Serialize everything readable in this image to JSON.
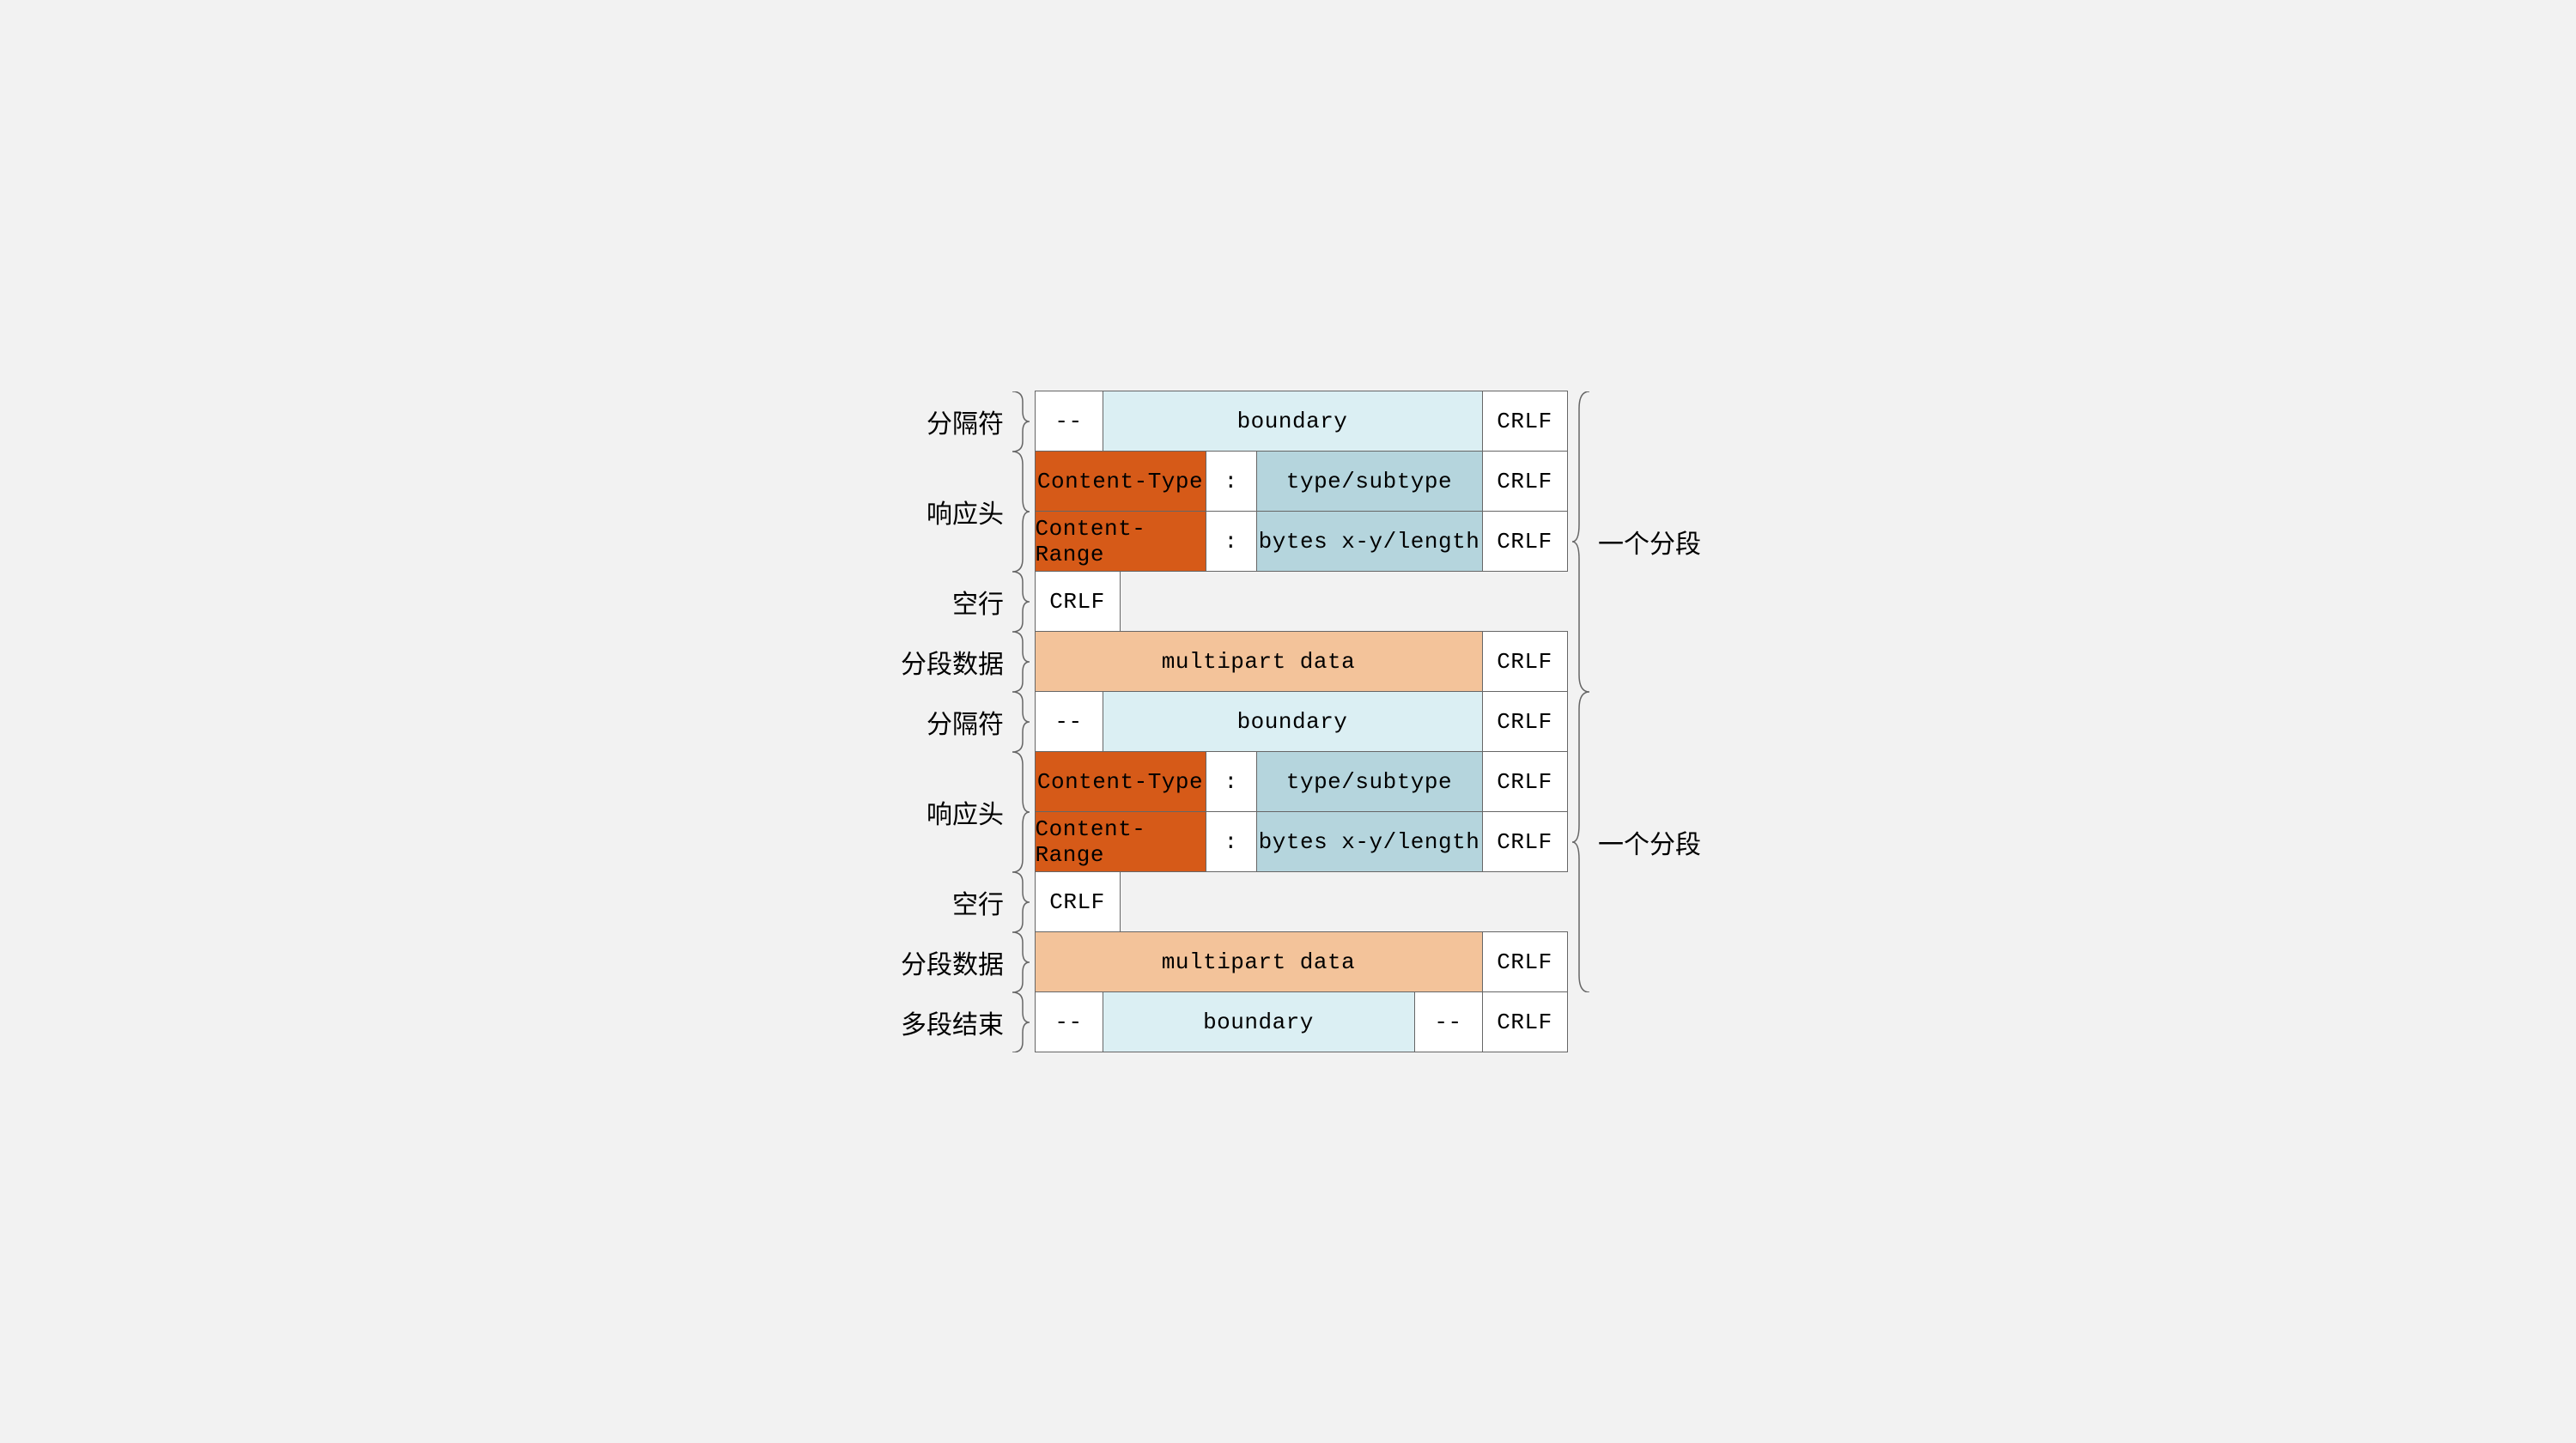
{
  "labels": {
    "separator": "分隔符",
    "response_header": "响应头",
    "blank_line": "空行",
    "segment_data": "分段数据",
    "multipart_end": "多段结束",
    "one_segment": "一个分段"
  },
  "tokens": {
    "dashdash": "--",
    "boundary": "boundary",
    "crlf": "CRLF",
    "content_type": "Content-Type",
    "content_range": "Content-Range",
    "colon": ":",
    "type_subtype": "type/subtype",
    "bytes_range": "bytes x-y/length",
    "multipart_data": "multipart data"
  },
  "colors": {
    "bg": "#f2f2f2",
    "white": "#ffffff",
    "light_blue": "#dbeff3",
    "mid_blue": "#b5d5dd",
    "orange": "#d65a18",
    "peach": "#f3c39a",
    "border": "#666666"
  }
}
